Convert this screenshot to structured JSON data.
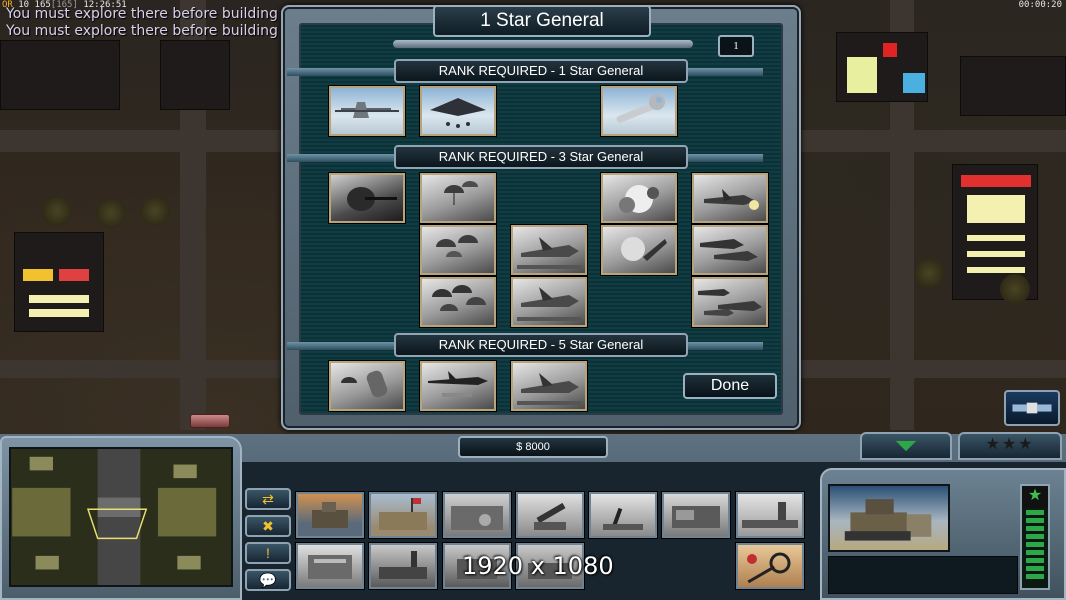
{
  "hud": {
    "stats": {
      "or": "OR",
      "num1": "10",
      "num2": "165",
      "num3": "[165]",
      "time": "12:26:51"
    },
    "clock": "00:00:20",
    "messages": [
      "You must explore there before building",
      "You must explore there before building"
    ]
  },
  "promotion": {
    "title": "1 Star General",
    "points": "1",
    "sections": [
      {
        "label": "RANK REQUIRED - 1 Star General"
      },
      {
        "label": "RANK REQUIRED - 3 Star General"
      },
      {
        "label": "RANK REQUIRED - 5 Star General"
      }
    ],
    "done_label": "Done"
  },
  "control_bar": {
    "money": "$ 8000",
    "side_buttons": [
      "⇄",
      "✖",
      "!",
      "💬"
    ],
    "stars_tab": "★★★",
    "resolution_overlay": "1920 x 1080",
    "star_badge": "★"
  }
}
